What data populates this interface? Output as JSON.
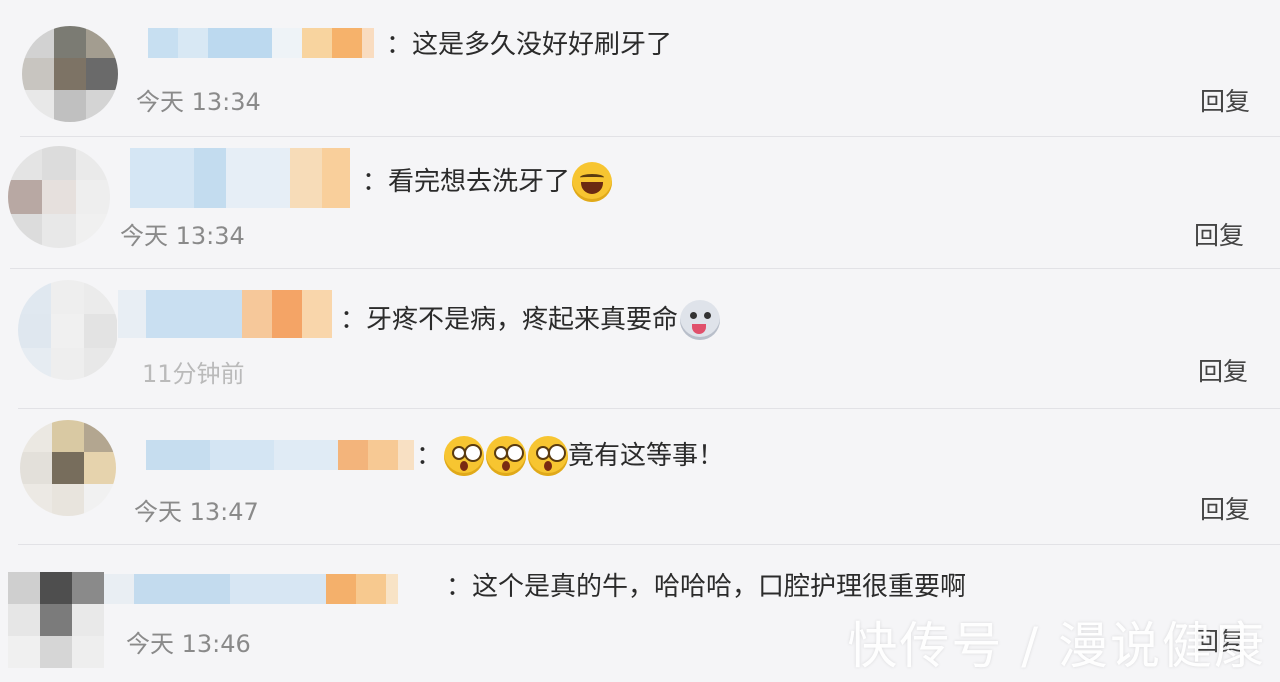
{
  "comments": [
    {
      "text": "：这是多久没好好刷牙了",
      "time": "今天 13:34",
      "reply": "回复",
      "emojis": []
    },
    {
      "text": "：看完想去洗牙了",
      "time": "今天 13:34",
      "reply": "回复",
      "emojis": [
        "laugh"
      ]
    },
    {
      "text": "：牙疼不是病，疼起来真要命",
      "time": "11分钟前",
      "reply": "回复",
      "emojis": [
        "dog"
      ]
    },
    {
      "text": "竟有这等事！",
      "time": "今天 13:47",
      "reply": "回复",
      "emojis": [
        "shock",
        "shock",
        "shock"
      ]
    },
    {
      "text": "：这个是真的牛，哈哈哈，口腔护理很重要啊",
      "time": "今天 13:46",
      "reply": "回复",
      "emojis": []
    }
  ],
  "colon": "：",
  "watermark": "快传号 / 漫说健康",
  "colors": {
    "background": "#f5f5f7",
    "text": "#2b2b2b",
    "time": "#8a8a8a",
    "nickname_blue": "#bcd9ef",
    "nickname_orange": "#f6b26b"
  }
}
